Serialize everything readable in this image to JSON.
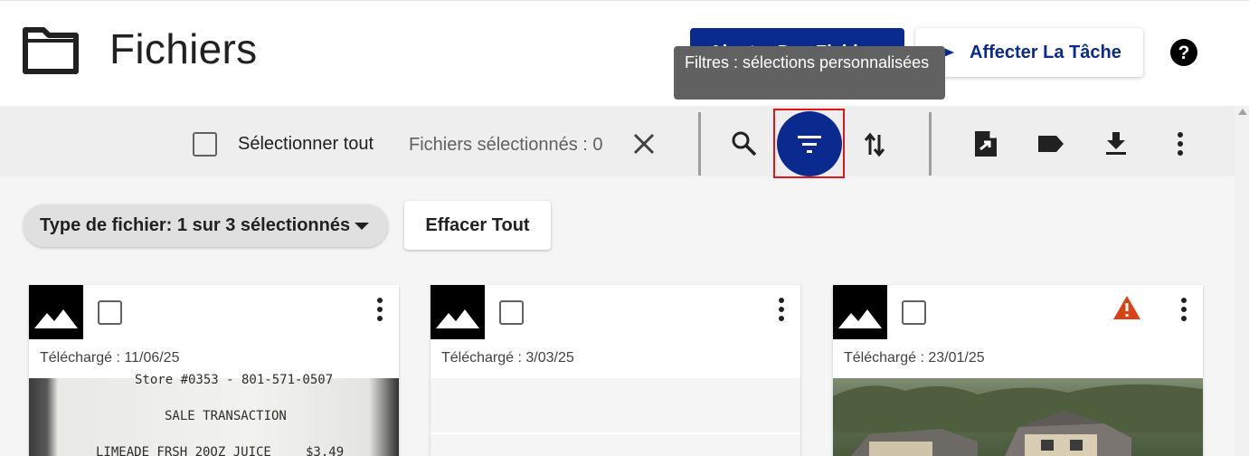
{
  "header": {
    "title": "Fichiers",
    "upload_button_label": "Ajouter Des Fichiers",
    "assign_button_label": "Affecter La Tâche",
    "folder_icon": "folder-icon",
    "help_icon": "help-icon"
  },
  "tooltip": {
    "text": "Filtres : sélections personnalisées"
  },
  "toolbar": {
    "select_all_label": "Sélectionner tout",
    "selected_count": "Fichiers sélectionnés : 0",
    "icons": [
      "close-icon",
      "search-icon",
      "filter-icon",
      "sort-icon",
      "export-file-icon",
      "label-icon",
      "download-icon",
      "more-vertical-icon"
    ]
  },
  "filters": {
    "file_type_chip": "Type de fichier: 1 sur 3 sélectionnés",
    "clear_all_label": "Effacer Tout"
  },
  "files": [
    {
      "uploaded": "Téléchargé : 11/06/25",
      "warning": false,
      "preview_lines": [
        "Store #0353 - 801-571-0507",
        "SALE TRANSACTION",
        "LIMEADE FRSH 20OZ JUICE",
        "$3.49"
      ]
    },
    {
      "uploaded": "Téléchargé : 3/03/25",
      "warning": false,
      "preview_lines": []
    },
    {
      "uploaded": "Téléchargé : 23/01/25",
      "warning": true,
      "preview_lines": []
    }
  ],
  "colors": {
    "brand_blue": "#0b2a8f",
    "highlight_red": "#e0161b",
    "warning_orange": "#d84315",
    "toolbar_bg": "#eeeeee"
  }
}
